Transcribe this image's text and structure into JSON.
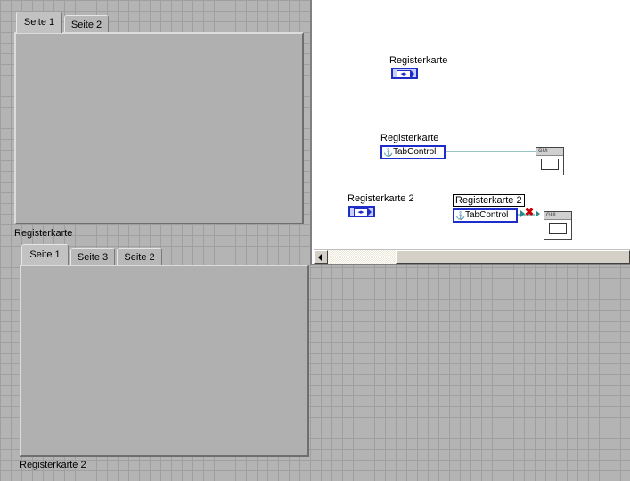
{
  "front_panel": {
    "tab_control_1": {
      "tabs": [
        {
          "label": "Seite 1"
        },
        {
          "label": "Seite 2"
        }
      ],
      "caption": "Registerkarte"
    },
    "tab_control_2": {
      "tabs": [
        {
          "label": "Seite 1"
        },
        {
          "label": "Seite 3"
        },
        {
          "label": "Seite 2"
        }
      ],
      "caption": "Registerkarte 2"
    }
  },
  "block_diagram": {
    "terminal_1": {
      "label": "Registerkarte"
    },
    "ref_node_1": {
      "label": "Registerkarte",
      "type": "TabControl"
    },
    "terminal_2": {
      "label": "Registerkarte 2"
    },
    "ref_node_2": {
      "label": "Registerkarte 2",
      "type": "TabControl"
    },
    "gui_box_label": "GUI",
    "colors": {
      "wire": "#2a8a8a",
      "terminal": "#1e2cc8",
      "error": "#cc0000"
    }
  }
}
